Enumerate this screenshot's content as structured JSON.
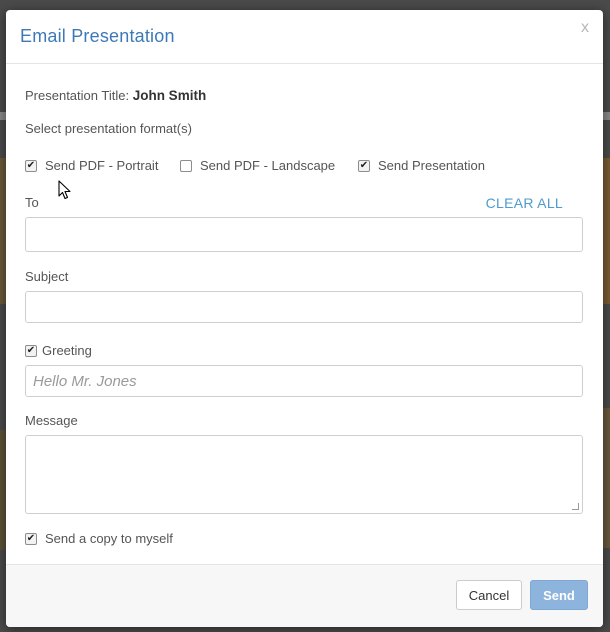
{
  "dialog": {
    "title": "Email Presentation",
    "close_label": "x"
  },
  "presentation": {
    "title_label": "Presentation Title:",
    "title_value": "John Smith"
  },
  "format": {
    "label": "Select presentation format(s)",
    "options": [
      {
        "label": "Send PDF - Portrait",
        "checked": true
      },
      {
        "label": "Send PDF - Landscape",
        "checked": false
      },
      {
        "label": "Send Presentation",
        "checked": true
      }
    ]
  },
  "to": {
    "label": "To",
    "clear_all": "CLEAR ALL",
    "value": ""
  },
  "subject": {
    "label": "Subject",
    "value": ""
  },
  "greeting": {
    "label": "Greeting",
    "checked": true,
    "placeholder": "Hello Mr. Jones"
  },
  "message": {
    "label": "Message",
    "value": ""
  },
  "copy": {
    "label": "Send a copy to myself",
    "checked": true
  },
  "footer": {
    "cancel_label": "Cancel",
    "send_label": "Send"
  },
  "colors": {
    "title": "#3d79b7",
    "link": "#4e9bcf",
    "send_button": "#8cb4dc"
  }
}
